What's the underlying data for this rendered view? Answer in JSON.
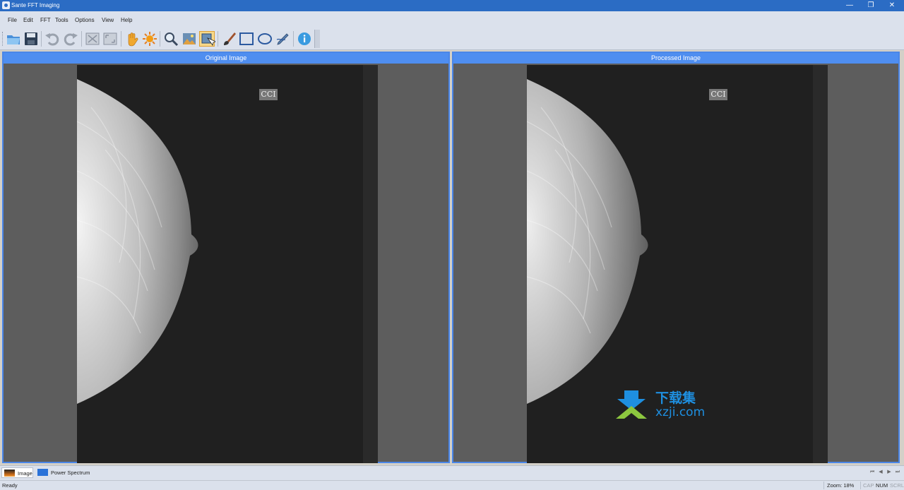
{
  "window": {
    "title": "Sante FFT Imaging",
    "minimize_glyph": "—",
    "restore_glyph": "❐",
    "close_glyph": "✕"
  },
  "menu": [
    "File",
    "Edit",
    "FFT",
    "Tools",
    "Options",
    "View",
    "Help"
  ],
  "toolbar": {
    "buttons": [
      "open-folder-icon",
      "save-icon",
      "undo-icon",
      "redo-icon",
      "fit-window-icon",
      "actual-size-icon",
      "pan-hand-icon",
      "brightness-icon",
      "zoom-icon",
      "image-adjust-icon",
      "region-select-icon",
      "brush-icon",
      "rectangle-icon",
      "ellipse-icon",
      "pen-icon",
      "info-icon"
    ],
    "active": "region-select-icon"
  },
  "panes": {
    "original": {
      "title": "Original Image",
      "marker": "CCI"
    },
    "processed": {
      "title": "Processed Image",
      "marker": "CCI"
    }
  },
  "watermark": {
    "cn": "下载集",
    "url": "xzji.com"
  },
  "tabs": [
    {
      "label": "Image",
      "active": true
    },
    {
      "label": "Power Spectrum",
      "active": false
    }
  ],
  "nav": [
    "⏮",
    "◀",
    "▶",
    "⏭"
  ],
  "status": {
    "text": "Ready",
    "zoom": "Zoom: 18%",
    "cap": "CAP",
    "num": "NUM",
    "scrl": "SCRL"
  },
  "colors": {
    "title_bar": "#2b6cc4",
    "pane_header": "#4f8ef0",
    "pane_border": "#4a86e8",
    "watermark_blue": "#1e8fe0",
    "watermark_green": "#8cc63f"
  }
}
